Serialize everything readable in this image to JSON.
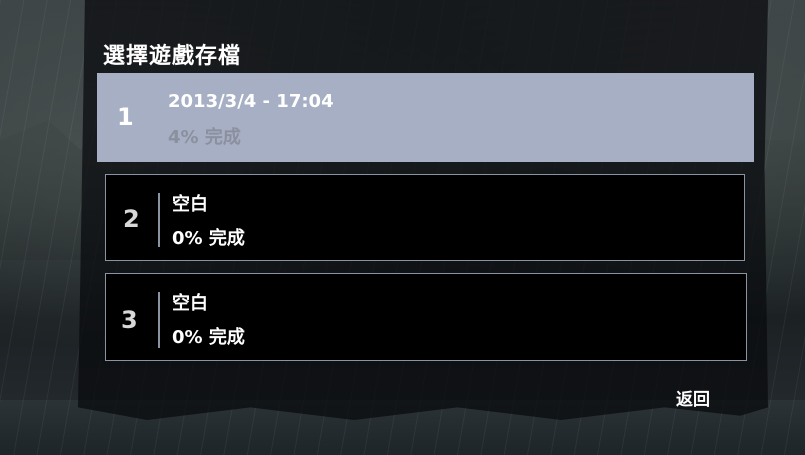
{
  "menu": {
    "title": "選擇遊戲存檔",
    "back_label": "返回"
  },
  "slots": [
    {
      "number": "1",
      "title": "2013/3/4  -  17:04",
      "progress": "4%  完成",
      "selected": true
    },
    {
      "number": "2",
      "title": "空白",
      "progress": "0%  完成",
      "selected": false
    },
    {
      "number": "3",
      "title": "空白",
      "progress": "0%  完成",
      "selected": false
    }
  ],
  "colors": {
    "selected_bg": "#a7afc4",
    "slot_border": "#8a93a2",
    "panel_bg": "#080a0c"
  }
}
